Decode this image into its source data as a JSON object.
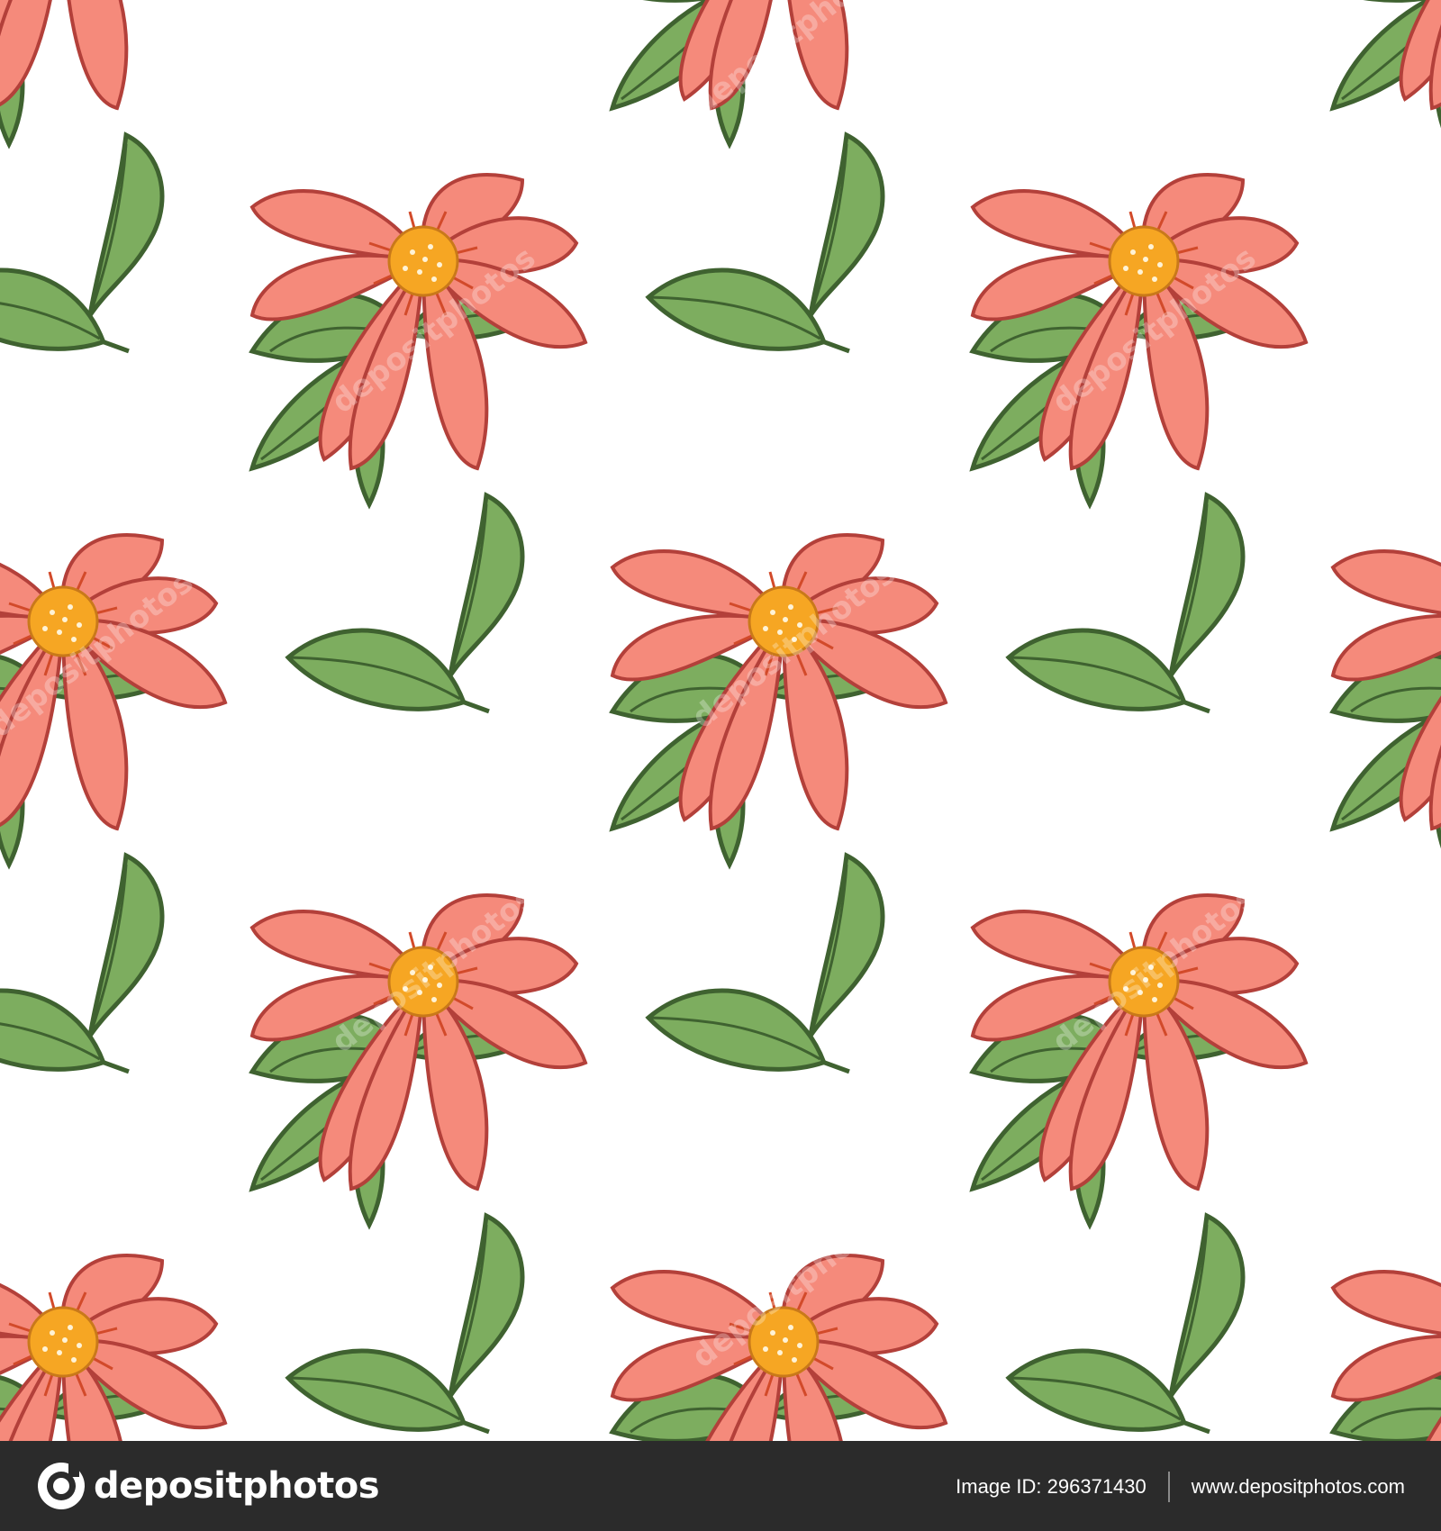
{
  "pattern": {
    "background": "#ffffff",
    "petal_fill": "#f58a7b",
    "petal_stroke": "#b3403a",
    "center_fill": "#f6a623",
    "center_spark": "#d24a2a",
    "leaf_fill": "#7dad5f",
    "leaf_stroke": "#3f6230",
    "watermark_text": "depositphotos"
  },
  "footer": {
    "background": "#2b2b2b",
    "brand": "depositphotos",
    "image_id_label": "Image ID: 296371430",
    "site": "www.depositphotos.com"
  }
}
